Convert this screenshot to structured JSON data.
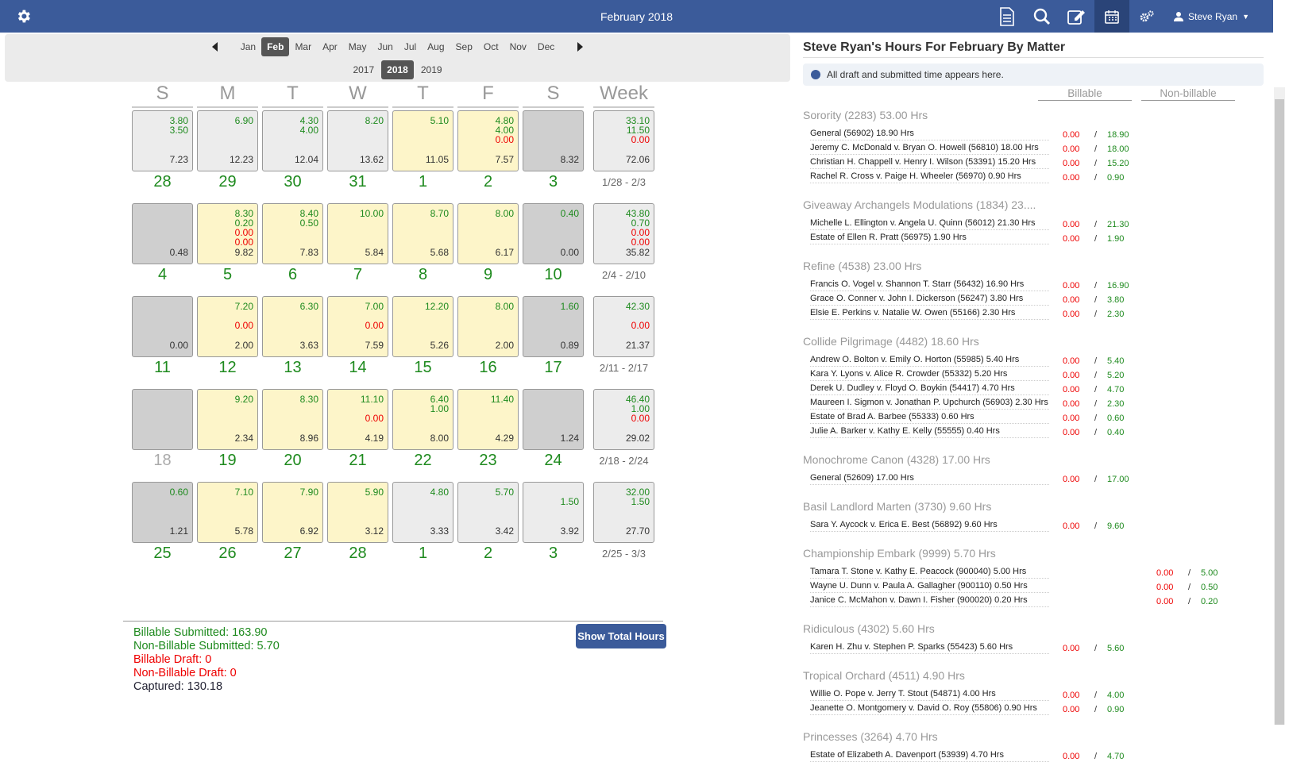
{
  "header": {
    "title": "February 2018",
    "user": "Steve Ryan"
  },
  "nav": {
    "months": [
      "Jan",
      "Feb",
      "Mar",
      "Apr",
      "May",
      "Jun",
      "Jul",
      "Aug",
      "Sep",
      "Oct",
      "Nov",
      "Dec"
    ],
    "selected_month": "Feb",
    "years": [
      "2017",
      "2018",
      "2019"
    ],
    "selected_year": "2018"
  },
  "day_headers": [
    "S",
    "M",
    "T",
    "W",
    "T",
    "F",
    "S",
    "Week"
  ],
  "weeks": [
    {
      "range": "1/28 - 2/3",
      "week_total": {
        "b": "33.10",
        "n": "11.50",
        "r": "0.00",
        "cap": "72.06"
      },
      "days": [
        {
          "d": "28",
          "style": "light",
          "vals": [
            [
              "3.80",
              "b"
            ],
            [
              "3.50",
              "b"
            ]
          ],
          "cap": "7.23"
        },
        {
          "d": "29",
          "style": "light",
          "vals": [
            [
              "6.90",
              "b"
            ]
          ],
          "cap": "12.23"
        },
        {
          "d": "30",
          "style": "light",
          "vals": [
            [
              "4.30",
              "b"
            ],
            [
              "4.00",
              "b"
            ]
          ],
          "cap": "12.04"
        },
        {
          "d": "31",
          "style": "light",
          "vals": [
            [
              "8.20",
              "b"
            ]
          ],
          "cap": "13.62"
        },
        {
          "d": "1",
          "style": "yellow",
          "vals": [
            [
              "5.10",
              "b"
            ]
          ],
          "cap": "11.05"
        },
        {
          "d": "2",
          "style": "yellow",
          "vals": [
            [
              "4.80",
              "b"
            ],
            [
              "4.00",
              "b"
            ],
            [
              "0.00",
              "r"
            ]
          ],
          "cap": "7.57"
        },
        {
          "d": "3",
          "style": "grey",
          "vals": [],
          "cap": "8.32"
        }
      ]
    },
    {
      "range": "2/4 - 2/10",
      "week_total": {
        "b": "43.80",
        "n": "0.70",
        "r": "0.00",
        "r2": "0.00",
        "cap": "35.82"
      },
      "days": [
        {
          "d": "4",
          "style": "grey",
          "vals": [],
          "cap": "0.48"
        },
        {
          "d": "5",
          "style": "yellow",
          "vals": [
            [
              "8.30",
              "b"
            ],
            [
              "0.20",
              "b"
            ],
            [
              "0.00",
              "r"
            ],
            [
              "0.00",
              "r"
            ]
          ],
          "cap": "9.82"
        },
        {
          "d": "6",
          "style": "yellow",
          "vals": [
            [
              "8.40",
              "b"
            ],
            [
              "0.50",
              "b"
            ]
          ],
          "cap": "7.83"
        },
        {
          "d": "7",
          "style": "yellow",
          "vals": [
            [
              "10.00",
              "b"
            ]
          ],
          "cap": "5.84"
        },
        {
          "d": "8",
          "style": "yellow",
          "vals": [
            [
              "8.70",
              "b"
            ]
          ],
          "cap": "5.68"
        },
        {
          "d": "9",
          "style": "yellow",
          "vals": [
            [
              "8.00",
              "b"
            ]
          ],
          "cap": "6.17"
        },
        {
          "d": "10",
          "style": "grey",
          "vals": [
            [
              "0.40",
              "b"
            ]
          ],
          "cap": "0.00"
        }
      ]
    },
    {
      "range": "2/11 - 2/17",
      "week_total": {
        "b": "42.30",
        "r": "0.00",
        "cap": "21.37"
      },
      "days": [
        {
          "d": "11",
          "style": "grey",
          "vals": [],
          "cap": "0.00"
        },
        {
          "d": "12",
          "style": "yellow",
          "vals": [
            [
              "7.20",
              "b"
            ],
            [
              "",
              "b"
            ],
            [
              "0.00",
              "r"
            ]
          ],
          "cap": "2.00"
        },
        {
          "d": "13",
          "style": "yellow",
          "vals": [
            [
              "6.30",
              "b"
            ]
          ],
          "cap": "3.63"
        },
        {
          "d": "14",
          "style": "yellow",
          "vals": [
            [
              "7.00",
              "b"
            ],
            [
              "",
              "b"
            ],
            [
              "0.00",
              "r"
            ]
          ],
          "cap": "7.59"
        },
        {
          "d": "15",
          "style": "yellow",
          "vals": [
            [
              "12.20",
              "b"
            ]
          ],
          "cap": "5.26"
        },
        {
          "d": "16",
          "style": "yellow",
          "vals": [
            [
              "8.00",
              "b"
            ]
          ],
          "cap": "2.00"
        },
        {
          "d": "17",
          "style": "grey",
          "vals": [
            [
              "1.60",
              "b"
            ]
          ],
          "cap": "0.89"
        }
      ]
    },
    {
      "range": "2/18 - 2/24",
      "week_total": {
        "b": "46.40",
        "n": "1.00",
        "r": "0.00",
        "cap": "29.02"
      },
      "days": [
        {
          "d": "18",
          "style": "grey",
          "vals": [],
          "cap": "",
          "dim": true
        },
        {
          "d": "19",
          "style": "yellow",
          "vals": [
            [
              "9.20",
              "b"
            ]
          ],
          "cap": "2.34"
        },
        {
          "d": "20",
          "style": "yellow",
          "vals": [
            [
              "8.30",
              "b"
            ]
          ],
          "cap": "8.96"
        },
        {
          "d": "21",
          "style": "yellow",
          "vals": [
            [
              "11.10",
              "b"
            ],
            [
              "",
              "b"
            ],
            [
              "0.00",
              "r"
            ]
          ],
          "cap": "4.19"
        },
        {
          "d": "22",
          "style": "yellow",
          "vals": [
            [
              "6.40",
              "b"
            ],
            [
              "1.00",
              "b"
            ]
          ],
          "cap": "8.00"
        },
        {
          "d": "23",
          "style": "yellow",
          "vals": [
            [
              "11.40",
              "b"
            ]
          ],
          "cap": "4.29"
        },
        {
          "d": "24",
          "style": "grey",
          "vals": [],
          "cap": "1.24"
        }
      ]
    },
    {
      "range": "2/25 - 3/3",
      "week_total": {
        "b": "32.00",
        "n": "1.50",
        "cap": "27.70"
      },
      "days": [
        {
          "d": "25",
          "style": "grey",
          "vals": [
            [
              "0.60",
              "b"
            ]
          ],
          "cap": "1.21"
        },
        {
          "d": "26",
          "style": "yellow",
          "vals": [
            [
              "7.10",
              "b"
            ]
          ],
          "cap": "5.78"
        },
        {
          "d": "27",
          "style": "yellow",
          "vals": [
            [
              "7.90",
              "b"
            ]
          ],
          "cap": "6.92"
        },
        {
          "d": "28",
          "style": "yellow",
          "vals": [
            [
              "5.90",
              "b"
            ]
          ],
          "cap": "3.12"
        },
        {
          "d": "1",
          "style": "light",
          "vals": [
            [
              "4.80",
              "b"
            ]
          ],
          "cap": "3.33"
        },
        {
          "d": "2",
          "style": "light",
          "vals": [
            [
              "5.70",
              "b"
            ]
          ],
          "cap": "3.42"
        },
        {
          "d": "3",
          "style": "light",
          "vals": [
            [
              "",
              "b"
            ],
            [
              "1.50",
              "b"
            ]
          ],
          "cap": "3.92"
        }
      ]
    }
  ],
  "summary": {
    "billable_submitted": "Billable Submitted: 163.90",
    "nonbillable_submitted": "Non-Billable Submitted: 5.70",
    "billable_draft": "Billable Draft: 0",
    "nonbillable_draft": "Non-Billable Draft: 0",
    "captured": "Captured: 130.18",
    "show_total_button": "Show Total Hours"
  },
  "right_panel": {
    "title": "Steve Ryan's Hours For February By Matter",
    "note": "All draft and submitted time appears here.",
    "col_billable": "Billable",
    "col_nonbillable": "Non-billable",
    "groups": [
      {
        "name": "Sorority (2283) 53.00 Hrs",
        "rows": [
          {
            "m": "General (56902) 18.90 Hrs",
            "b": "0.00",
            "n": "18.90"
          },
          {
            "m": "Jeremy C. McDonald v. Bryan O. Howell (56810) 18.00 Hrs",
            "b": "0.00",
            "n": "18.00"
          },
          {
            "m": "Christian H. Chappell v. Henry I. Wilson (53391) 15.20 Hrs",
            "b": "0.00",
            "n": "15.20"
          },
          {
            "m": "Rachel R. Cross v. Paige H. Wheeler (56970) 0.90 Hrs",
            "b": "0.00",
            "n": "0.90"
          }
        ]
      },
      {
        "name": "Giveaway Archangels Modulations (1834) 23....",
        "rows": [
          {
            "m": "Michelle L. Ellington v. Angela U. Quinn (56012) 21.30 Hrs",
            "b": "0.00",
            "n": "21.30"
          },
          {
            "m": "Estate of Ellen R. Pratt (56975) 1.90 Hrs",
            "b": "0.00",
            "n": "1.90"
          }
        ]
      },
      {
        "name": "Refine (4538) 23.00 Hrs",
        "rows": [
          {
            "m": "Francis O. Vogel v. Shannon T. Starr (56432) 16.90 Hrs",
            "b": "0.00",
            "n": "16.90"
          },
          {
            "m": "Grace O. Conner v. John I. Dickerson (56247) 3.80 Hrs",
            "b": "0.00",
            "n": "3.80"
          },
          {
            "m": "Elsie E. Perkins v. Natalie W. Owen (55166) 2.30 Hrs",
            "b": "0.00",
            "n": "2.30"
          }
        ]
      },
      {
        "name": "Collide Pilgrimage (4482) 18.60 Hrs",
        "rows": [
          {
            "m": "Andrew O. Bolton v. Emily O. Horton (55985) 5.40 Hrs",
            "b": "0.00",
            "n": "5.40"
          },
          {
            "m": "Kara Y. Lyons v. Alice R. Crowder (55332) 5.20 Hrs",
            "b": "0.00",
            "n": "5.20"
          },
          {
            "m": "Derek U. Dudley v. Floyd O. Boykin (54417) 4.70 Hrs",
            "b": "0.00",
            "n": "4.70"
          },
          {
            "m": "Maureen I. Sigmon v. Jonathan P. Upchurch (56903) 2.30 Hrs",
            "b": "0.00",
            "n": "2.30"
          },
          {
            "m": "Estate of Brad A. Barbee (55333) 0.60 Hrs",
            "b": "0.00",
            "n": "0.60"
          },
          {
            "m": "Julie A. Barker v. Kathy E. Kelly (55555) 0.40 Hrs",
            "b": "0.00",
            "n": "0.40"
          }
        ]
      },
      {
        "name": "Monochrome Canon (4328) 17.00 Hrs",
        "rows": [
          {
            "m": "General (52609) 17.00 Hrs",
            "b": "0.00",
            "n": "17.00"
          }
        ]
      },
      {
        "name": "Basil Landlord Marten (3730) 9.60 Hrs",
        "rows": [
          {
            "m": "Sara Y. Aycock v. Erica E. Best (56892) 9.60 Hrs",
            "b": "0.00",
            "n": "9.60"
          }
        ]
      },
      {
        "name": "Championship Embark (9999) 5.70 Hrs",
        "shift": true,
        "rows": [
          {
            "m": "Tamara T. Stone v. Kathy E. Peacock (900040) 5.00 Hrs",
            "b": "0.00",
            "n": "5.00"
          },
          {
            "m": "Wayne U. Dunn v. Paula A. Gallagher (900110) 0.50 Hrs",
            "b": "0.00",
            "n": "0.50"
          },
          {
            "m": "Janice C. McMahon v. Dawn I. Fisher (900020) 0.20 Hrs",
            "b": "0.00",
            "n": "0.20"
          }
        ]
      },
      {
        "name": "Ridiculous (4302) 5.60 Hrs",
        "rows": [
          {
            "m": "Karen H. Zhu v. Stephen P. Sparks (55423) 5.60 Hrs",
            "b": "0.00",
            "n": "5.60"
          }
        ]
      },
      {
        "name": "Tropical Orchard (4511) 4.90 Hrs",
        "rows": [
          {
            "m": "Willie O. Pope v. Jerry T. Stout (54871) 4.00 Hrs",
            "b": "0.00",
            "n": "4.00"
          },
          {
            "m": "Jeanette O. Montgomery v. David O. Roy (55806) 0.90 Hrs",
            "b": "0.00",
            "n": "0.90"
          }
        ]
      },
      {
        "name": "Princesses (3264) 4.70 Hrs",
        "rows": [
          {
            "m": "Estate of Elizabeth A. Davenport (53939) 4.70 Hrs",
            "b": "0.00",
            "n": "4.70"
          }
        ]
      }
    ]
  },
  "colors": {
    "header": "#3b5b9a",
    "green": "#1e8a1e",
    "red": "#ee0000",
    "yellow_cell": "#fdf5c9"
  }
}
